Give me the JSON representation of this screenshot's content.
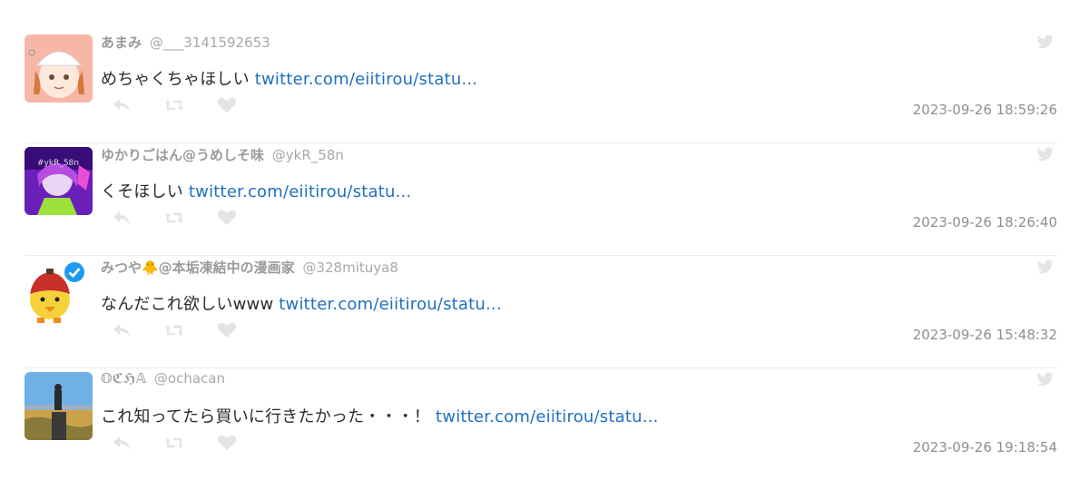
{
  "tweets": [
    {
      "name": "あまみ",
      "handle": "@___3141592653",
      "text": "めちゃくちゃほしい",
      "link": "twitter.com/eiitirou/statu...",
      "timestamp": "2023-09-26 18:59:26",
      "avatar_icon": "girl-avatar"
    },
    {
      "name": "ゆかりごはん@うめしそ味",
      "handle": "@ykR_58n",
      "text": "くそほしい",
      "link": "twitter.com/eiitirou/statu...",
      "timestamp": "2023-09-26 18:26:40",
      "avatar_icon": "purple-avatar"
    },
    {
      "name": "みつや🐥@本垢凍結中の漫画家",
      "handle": "@328mituya8",
      "text": "なんだこれ欲しいwww",
      "link": "twitter.com/eiitirou/statu...",
      "timestamp": "2023-09-26 15:48:32",
      "avatar_icon": "yellow-chick-avatar",
      "verified": true
    },
    {
      "name": "𝕆ℭℌ𝔸",
      "handle": "@ochacan",
      "text": "これ知ってたら買いに行きたかった・・・！",
      "link": "twitter.com/eiitirou/statu...",
      "timestamp": "2023-09-26 19:18:54",
      "avatar_icon": "landscape-photo-avatar"
    }
  ],
  "colors": {
    "link": "#1f6fc0",
    "meta": "#9a9a9a",
    "icon": "#e4e4e4",
    "verified": "#1d9bf0"
  }
}
